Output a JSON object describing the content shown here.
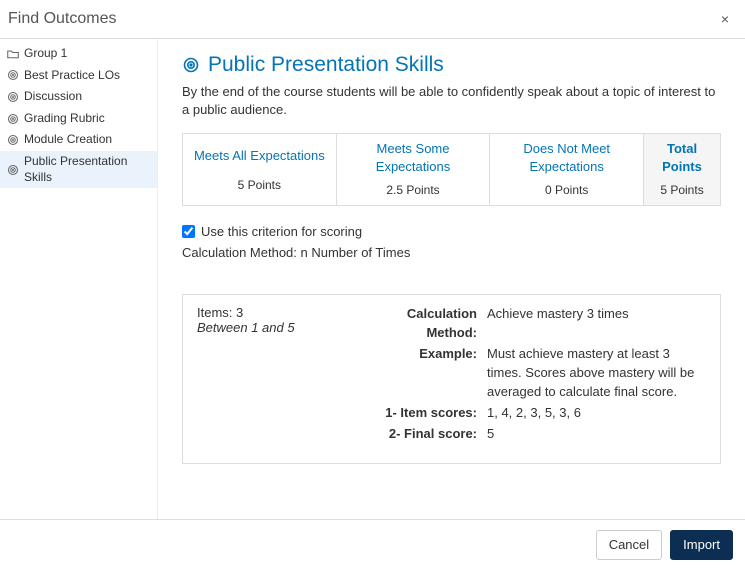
{
  "header": {
    "title": "Find Outcomes",
    "close": "×"
  },
  "sidebar": {
    "items": [
      {
        "label": "Group 1",
        "icon": "folder"
      },
      {
        "label": "Best Practice LOs",
        "icon": "target"
      },
      {
        "label": "Discussion",
        "icon": "target"
      },
      {
        "label": "Grading Rubric",
        "icon": "target"
      },
      {
        "label": "Module Creation",
        "icon": "target"
      },
      {
        "label": "Public Presentation Skills",
        "icon": "target",
        "selected": true
      }
    ]
  },
  "outcome": {
    "title": "Public Presentation Skills",
    "description": "By the end of the course students will be able to confidently speak about a topic of interest to a public audience.",
    "criteria": [
      {
        "title": "Meets All Expectations",
        "points": "5 Points"
      },
      {
        "title": "Meets Some Expectations",
        "points": "2.5 Points"
      },
      {
        "title": "Does Not Meet Expectations",
        "points": "0 Points"
      }
    ],
    "total": {
      "title": "Total Points",
      "points": "5 Points"
    },
    "use_for_scoring_label": "Use this criterion for scoring",
    "use_for_scoring_checked": true,
    "calc_method_line": "Calculation Method: n Number of Times",
    "detail": {
      "items_line": "Items: 3",
      "range_line": "Between 1 and 5",
      "rows": [
        {
          "k": "Calculation Method:",
          "v": "Achieve mastery 3 times"
        },
        {
          "k": "Example:",
          "v": "Must achieve mastery at least 3 times. Scores above mastery will be averaged to calculate final score."
        },
        {
          "k": "1- Item scores:",
          "v": "1, 4, 2, 3, 5, 3, 6"
        },
        {
          "k": "2- Final score:",
          "v": "5"
        }
      ]
    }
  },
  "footer": {
    "cancel": "Cancel",
    "import": "Import"
  },
  "colors": {
    "accent": "#0374B5",
    "primary_btn": "#0b2e52"
  }
}
